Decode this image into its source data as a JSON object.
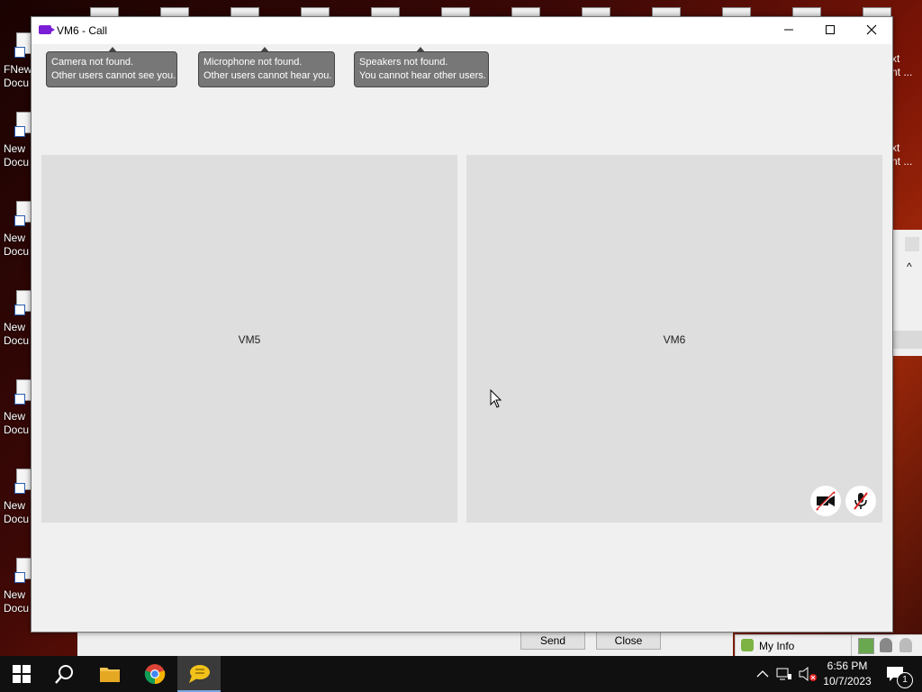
{
  "window": {
    "title": "VM6 - Call",
    "minimize_icon": "minimize-icon",
    "maximize_icon": "maximize-icon",
    "close_icon": "close-icon"
  },
  "notices": [
    {
      "line1": "Camera not found.",
      "line2": "Other users cannot see you."
    },
    {
      "line1": "Microphone not found.",
      "line2": "Other users cannot hear you."
    },
    {
      "line1": "Speakers not found.",
      "line2": "You cannot hear other users."
    }
  ],
  "participants": [
    {
      "name": "VM5"
    },
    {
      "name": "VM6"
    }
  ],
  "controls": {
    "camera_icon": "camera-off-icon",
    "mic_icon": "mic-off-icon"
  },
  "background_window": {
    "send_label": "Send",
    "close_label": "Close"
  },
  "myinfo": {
    "label": "My Info"
  },
  "desktop_icons": [
    {
      "label": "FNew\nDocu"
    },
    {
      "label": "New\nDocu"
    },
    {
      "label": "New\nDocu"
    },
    {
      "label": "New\nDocu"
    },
    {
      "label": "New\nDocu"
    },
    {
      "label": "New\nDocu"
    },
    {
      "label": "New\nDocu"
    }
  ],
  "right_desktop_labels": [
    {
      "label": "xt\nnt ..."
    },
    {
      "label": "xt\nnt ..."
    }
  ],
  "taskbar": {
    "time": "6:56 PM",
    "date": "10/7/2023",
    "notification_count": "1"
  }
}
